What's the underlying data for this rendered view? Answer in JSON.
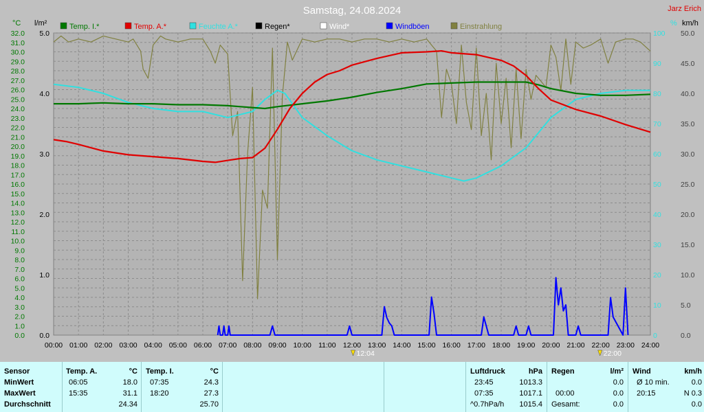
{
  "title": "Samstag, 24.08.2024",
  "author": "Jarz Erich",
  "colors": {
    "background": "#c0c0c0",
    "plot_bg": "#b4b4b4",
    "temp_in": "#007800",
    "temp_out": "#e00000",
    "humidity": "#30e0e0",
    "rain": "#000000",
    "wind": "#ffffff",
    "gust": "#0000ff",
    "irradiance": "#808040",
    "table_bg": "#d0fcfc"
  },
  "chart_data": {
    "type": "line",
    "title": "Samstag, 24.08.2024",
    "unit_labels": {
      "temp": "°C",
      "rain": "l/m²",
      "humidity": "%",
      "wind": "km/h"
    },
    "x_ticks": [
      "00:00",
      "01:00",
      "02:00",
      "03:00",
      "04:00",
      "05:00",
      "06:00",
      "07:00",
      "08:00",
      "09:00",
      "10:00",
      "11:00",
      "12:00",
      "13:00",
      "14:00",
      "15:00",
      "16:00",
      "17:00",
      "18:00",
      "19:00",
      "20:00",
      "21:00",
      "22:00",
      "23:00",
      "24:00"
    ],
    "x_range": [
      0,
      24
    ],
    "temp_axis": {
      "min": 0,
      "max": 32,
      "step": 1,
      "ticks": [
        "0.0",
        "1.0",
        "2.0",
        "3.0",
        "4.0",
        "5.0",
        "6.0",
        "7.0",
        "8.0",
        "9.0",
        "10.0",
        "11.0",
        "12.0",
        "13.0",
        "14.0",
        "15.0",
        "16.0",
        "17.0",
        "18.0",
        "19.0",
        "20.0",
        "21.0",
        "22.0",
        "23.0",
        "24.0",
        "25.0",
        "26.0",
        "27.0",
        "28.0",
        "29.0",
        "30.0",
        "31.0",
        "32.0"
      ]
    },
    "rain_axis": {
      "min": 0,
      "max": 5,
      "ticks": [
        "0.0",
        "1.0",
        "2.0",
        "3.0",
        "4.0",
        "5.0"
      ]
    },
    "humidity_axis": {
      "min": 0,
      "max": 100,
      "ticks": [
        "0",
        "10",
        "20",
        "30",
        "40",
        "50",
        "60",
        "70",
        "80",
        "90",
        "100"
      ]
    },
    "wind_axis": {
      "min": 0,
      "max": 50,
      "ticks": [
        "0.0",
        "5.0",
        "10.0",
        "15.0",
        "20.0",
        "25.0",
        "30.0",
        "35.0",
        "40.0",
        "45.0",
        "50.0"
      ]
    },
    "grid": true,
    "legend_position": "top",
    "legend": [
      {
        "name": "Temp. I.*",
        "color": "#007800"
      },
      {
        "name": "Temp. A.*",
        "color": "#e00000"
      },
      {
        "name": "Feuchte A.*",
        "color": "#30e0e0"
      },
      {
        "name": "Regen*",
        "color": "#000000"
      },
      {
        "name": "Wind*",
        "color": "#ffffff"
      },
      {
        "name": "Windböen",
        "color": "#0000ff"
      },
      {
        "name": "Einstrahlung",
        "color": "#808040"
      }
    ],
    "markers": [
      {
        "time": 12.07,
        "label": "12:04"
      },
      {
        "time": 22.0,
        "label": "22:00"
      }
    ],
    "series": [
      {
        "name": "Temp. I.*",
        "axis": "temp",
        "x": [
          0,
          1,
          2,
          3,
          4,
          5,
          6,
          7,
          7.5,
          8.5,
          9,
          10,
          11,
          12,
          13,
          14,
          15,
          16,
          17,
          18,
          19,
          19.5,
          20,
          21,
          22,
          23,
          24
        ],
        "y": [
          24.5,
          24.5,
          24.6,
          24.5,
          24.5,
          24.4,
          24.4,
          24.3,
          24.2,
          24.0,
          24.2,
          24.5,
          24.8,
          25.2,
          25.7,
          26.1,
          26.6,
          26.7,
          26.8,
          26.8,
          26.8,
          26.5,
          26.1,
          25.6,
          25.4,
          25.4,
          25.5
        ]
      },
      {
        "name": "Temp. A.*",
        "axis": "temp",
        "x": [
          0,
          0.5,
          1,
          2,
          3,
          4,
          5,
          6,
          6.5,
          7,
          7.5,
          8,
          8.5,
          9,
          9.5,
          10,
          10.5,
          11,
          11.5,
          12,
          13,
          14,
          15,
          15.6,
          16,
          17,
          18,
          18.5,
          19,
          19.5,
          20,
          21,
          22,
          23,
          23.5,
          24
        ],
        "y": [
          20.7,
          20.5,
          20.2,
          19.5,
          19.1,
          18.9,
          18.7,
          18.4,
          18.3,
          18.5,
          18.7,
          18.8,
          19.8,
          21.8,
          24.0,
          25.6,
          26.8,
          27.6,
          28.0,
          28.6,
          29.3,
          29.9,
          30.0,
          30.1,
          29.9,
          29.7,
          29.1,
          28.5,
          27.5,
          26.1,
          24.9,
          23.9,
          23.2,
          22.3,
          21.9,
          21.5
        ]
      },
      {
        "name": "Feuchte A.*",
        "axis": "humidity",
        "x": [
          0,
          1,
          2,
          3,
          4,
          5,
          6,
          7,
          7.5,
          8,
          8.5,
          9,
          9.3,
          10,
          11,
          12,
          13,
          14,
          15,
          16,
          16.5,
          17,
          18,
          19,
          19.5,
          20,
          21,
          22,
          23,
          24
        ],
        "y": [
          83,
          82,
          80,
          77,
          75,
          74,
          74,
          72,
          73,
          74,
          78,
          81,
          80,
          72,
          66,
          61,
          58,
          56,
          54,
          52,
          51,
          52,
          56,
          62,
          67,
          72,
          78,
          80,
          81,
          81
        ]
      },
      {
        "name": "Einstrahlung",
        "axis": "humidity",
        "x": [
          0,
          0.3,
          0.6,
          1,
          1.5,
          2,
          2.5,
          3,
          3.2,
          3.5,
          3.6,
          3.8,
          4,
          4.3,
          4.5,
          5,
          5.5,
          6,
          6.3,
          6.5,
          6.7,
          7,
          7.2,
          7.4,
          7.6,
          7.8,
          8,
          8.2,
          8.4,
          8.6,
          8.8,
          9,
          9.2,
          9.4,
          9.6,
          10,
          10.5,
          11,
          11.5,
          12,
          12.5,
          13,
          13.5,
          14,
          14.5,
          15,
          15.2,
          15.4,
          15.6,
          15.8,
          16,
          16.2,
          16.4,
          16.6,
          16.8,
          17,
          17.2,
          17.4,
          17.6,
          17.8,
          18,
          18.2,
          18.4,
          18.6,
          18.8,
          19,
          19.2,
          19.4,
          19.6,
          19.8,
          20,
          20.2,
          20.4,
          20.6,
          20.8,
          21,
          21.3,
          21.6,
          22,
          22.3,
          22.6,
          23,
          23.3,
          23.6,
          24
        ],
        "y": [
          97,
          99,
          97,
          98,
          97,
          99,
          98,
          97,
          98,
          94,
          88,
          85,
          96,
          99,
          98,
          97,
          98,
          98,
          94,
          90,
          96,
          93,
          66,
          74,
          18,
          60,
          82,
          12,
          48,
          42,
          95,
          25,
          79,
          97,
          91,
          98,
          97,
          98,
          98,
          97,
          98,
          98,
          97,
          98,
          97,
          98,
          96,
          94,
          72,
          88,
          83,
          70,
          96,
          77,
          68,
          95,
          66,
          80,
          58,
          90,
          70,
          85,
          62,
          88,
          65,
          88,
          78,
          86,
          84,
          82,
          96,
          92,
          81,
          98,
          83,
          97,
          95,
          96,
          98,
          90,
          97,
          98,
          98,
          97,
          94
        ]
      },
      {
        "name": "Windböen",
        "axis": "wind",
        "x": [
          6.6,
          6.65,
          6.7,
          6.8,
          6.85,
          6.9,
          7.0,
          7.05,
          7.1,
          8.7,
          8.8,
          8.9,
          11.8,
          11.9,
          12.0,
          13.2,
          13.3,
          13.4,
          13.5,
          13.6,
          13.7,
          15.1,
          15.2,
          15.3,
          15.4,
          17.2,
          17.3,
          17.4,
          17.5,
          18.5,
          18.6,
          18.7,
          19.0,
          19.1,
          19.2,
          20.1,
          20.2,
          20.3,
          20.4,
          20.5,
          20.6,
          20.7,
          21.0,
          21.1,
          21.2,
          22.3,
          22.4,
          22.5,
          22.9,
          23.0,
          23.1
        ],
        "y": [
          0,
          1.5,
          0,
          0,
          1.5,
          0,
          0,
          1.5,
          0,
          0,
          1.5,
          0,
          0,
          1.5,
          0,
          0,
          4.7,
          2.9,
          2.0,
          1.5,
          0,
          0,
          6.3,
          3.5,
          0,
          0,
          3.0,
          1.5,
          0,
          0,
          1.5,
          0,
          0,
          1.5,
          0,
          0,
          9.5,
          5.0,
          7.8,
          4.0,
          5.0,
          0,
          0,
          1.5,
          0,
          0,
          6.2,
          3.0,
          0,
          7.8,
          0
        ]
      }
    ]
  },
  "table": {
    "sensor": {
      "header": "Sensor",
      "rows": [
        "MinWert",
        "MaxWert",
        "Durchschnitt"
      ]
    },
    "temp_a": {
      "header": "Temp. A.",
      "unit": "°C",
      "min_time": "06:05",
      "min": "18.0",
      "max_time": "15:35",
      "max": "31.1",
      "avg": "24.34"
    },
    "temp_i": {
      "header": "Temp. I.",
      "unit": "°C",
      "min_time": "07:35",
      "min": "24.3",
      "max_time": "18:20",
      "max": "27.3",
      "avg": "25.70"
    },
    "pressure": {
      "header": "Luftdruck",
      "unit": "hPa",
      "min_time": "23:45",
      "min": "1013.3",
      "max_time": "07:35",
      "max": "1017.1",
      "trend": "^0.7hPa/h",
      "avg": "1015.4"
    },
    "rain": {
      "header": "Regen",
      "unit": "l/m²",
      "r2_time": "00:00",
      "r2": "0.0",
      "r1": "0.0",
      "total_label": "Gesamt:",
      "total": "0.0"
    },
    "wind": {
      "header": "Wind",
      "unit": "km/h",
      "avg_label": "Ø 10 min.",
      "avg": "0.0",
      "max_time": "20:15",
      "max": "N 0.3",
      "r3": "0.0"
    }
  }
}
